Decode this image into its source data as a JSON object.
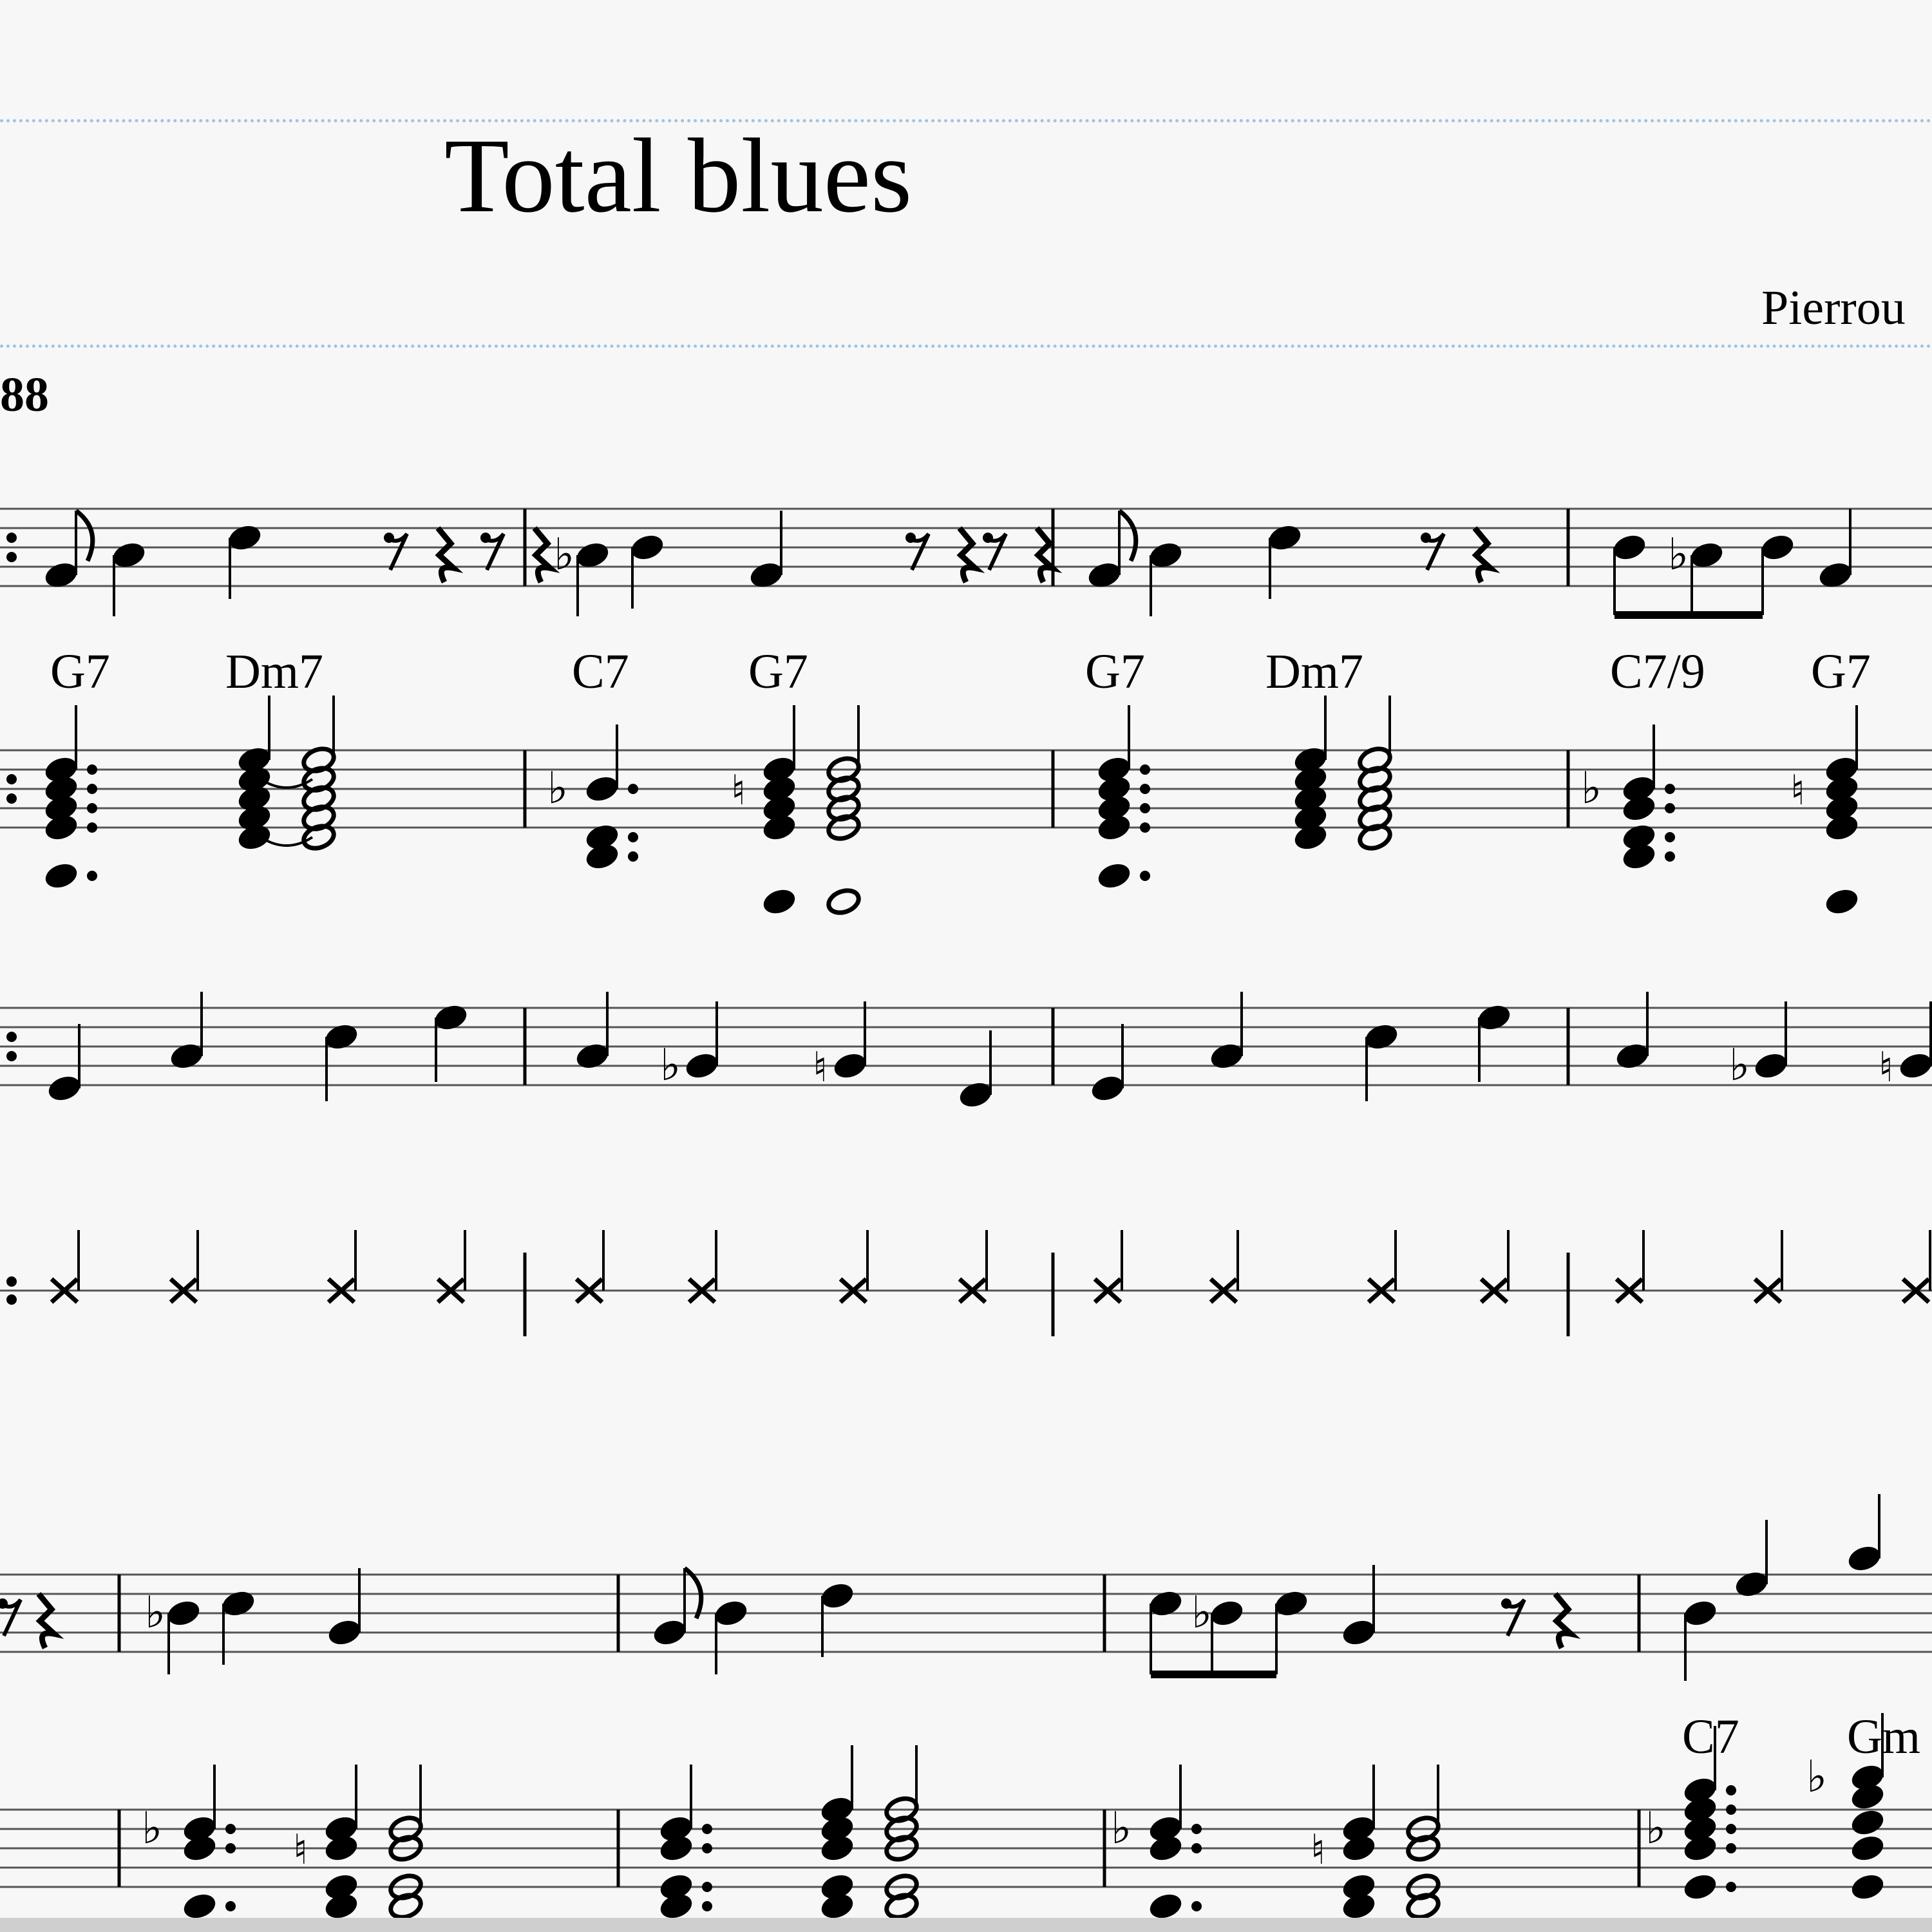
{
  "score": {
    "title": "Total blues",
    "composer": "Pierrou",
    "tempo": "88"
  },
  "chords": {
    "system1": [
      "G7",
      "Dm7",
      "C7",
      "G7",
      "G7",
      "Dm7",
      "C7/9",
      "G7"
    ],
    "system2": [
      "C7",
      "Gm"
    ]
  },
  "colors": {
    "background": "#f7f7f7",
    "ink": "#000000",
    "staff_line": "#555555",
    "guide_line": "#9ec3e6"
  }
}
